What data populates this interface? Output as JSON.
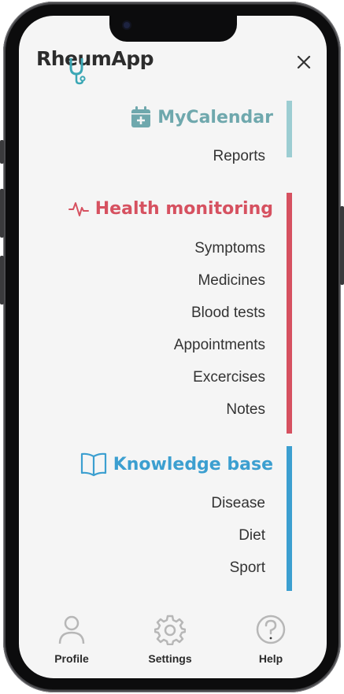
{
  "app": {
    "logo_text": "RheumApp"
  },
  "header": {
    "close_icon": "close-icon"
  },
  "colors": {
    "calendar": "#6fa8ad",
    "calendar_bar": "#9ccdd2",
    "health": "#d65160",
    "knowledge": "#3c9fd0",
    "nav_icon": "#b7b7b7"
  },
  "sections": {
    "calendar": {
      "title": "MyCalendar",
      "icon": "calendar-plus-icon",
      "items": [
        "Reports"
      ]
    },
    "health": {
      "title": "Health monitoring",
      "icon": "heartbeat-icon",
      "items": [
        "Symptoms",
        "Medicines",
        "Blood tests",
        "Appointments",
        "Excercises",
        "Notes"
      ]
    },
    "knowledge": {
      "title": "Knowledge base",
      "icon": "book-icon",
      "items": [
        "Disease",
        "Diet",
        "Sport"
      ]
    }
  },
  "bottom_nav": [
    {
      "label": "Profile",
      "icon": "user-icon"
    },
    {
      "label": "Settings",
      "icon": "gear-icon"
    },
    {
      "label": "Help",
      "icon": "help-icon"
    }
  ]
}
